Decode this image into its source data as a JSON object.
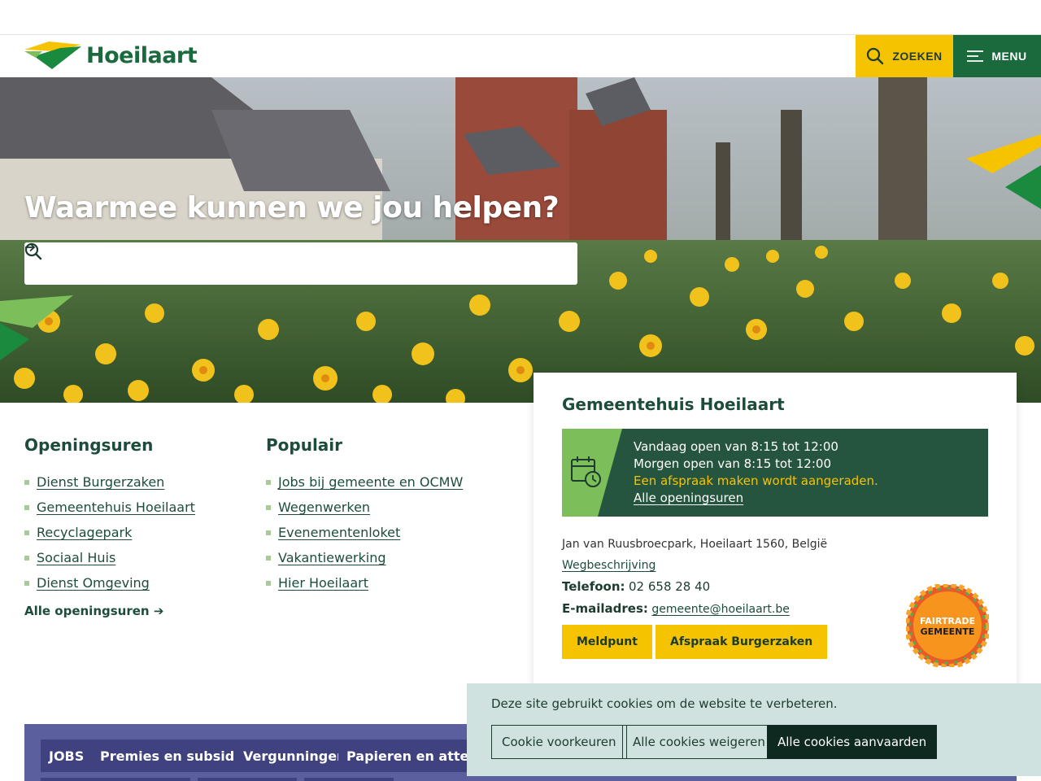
{
  "header": {
    "logo_text": "Hoeilaart",
    "search_label": "ZOEKEN",
    "menu_label": "MENU"
  },
  "hero": {
    "title": "Waarmee kunnen we jou helpen?",
    "search_placeholder": ""
  },
  "openingsuren": {
    "heading": "Openingsuren",
    "items": [
      {
        "label": "Dienst Burgerzaken"
      },
      {
        "label": "Gemeentehuis Hoeilaart"
      },
      {
        "label": "Recyclagepark"
      },
      {
        "label": "Sociaal Huis"
      },
      {
        "label": "Dienst Omgeving"
      }
    ],
    "all_link": "Alle openingsuren ➔"
  },
  "populair": {
    "heading": "Populair",
    "items": [
      {
        "label": "Jobs bij gemeente en OCMW"
      },
      {
        "label": "Wegenwerken"
      },
      {
        "label": "Evenementenloket"
      },
      {
        "label": "Vakantiewerking"
      },
      {
        "label": "Hier Hoeilaart"
      }
    ]
  },
  "card": {
    "title": "Gemeentehuis Hoeilaart",
    "today": "Vandaag open van 8:15 tot 12:00",
    "tomorrow": "Morgen open van 8:15 tot 12:00",
    "appointment_note": "Een afspraak maken wordt aangeraden.",
    "all_hours_link": "Alle openingsuren",
    "address": "Jan van Ruusbroecpark, Hoeilaart 1560, België",
    "directions_link": "Wegbeschrijving",
    "phone_label": "Telefoon:",
    "phone_value": "02 658 28 40",
    "email_label": "E-mailadres:",
    "email_value": "gemeente@hoeilaart.be",
    "button_meldpunt": "Meldpunt",
    "button_afspraak": "Afspraak Burgerzaken",
    "fairtrade_line1": "FAIRTRADE",
    "fairtrade_line2": "GEMEENTE"
  },
  "tags": [
    {
      "label": "JOBS"
    },
    {
      "label": "Premies en subsidies"
    },
    {
      "label": "Vergunningen"
    },
    {
      "label": "Papieren en attesten"
    }
  ],
  "cookie": {
    "message": "Deze site gebruikt cookies om de website te verbeteren.",
    "preferences": "Cookie voorkeuren",
    "reject_all": "Alle cookies weigeren",
    "accept_all": "Alle cookies aanvaarden"
  },
  "colors": {
    "brand_green": "#1a6a3e",
    "dark_green": "#25543f",
    "accent_yellow": "#f6c300",
    "light_green": "#7cbf5a",
    "tag_purple": "#5b5f9e",
    "cookie_bg": "#cfe2e0"
  }
}
